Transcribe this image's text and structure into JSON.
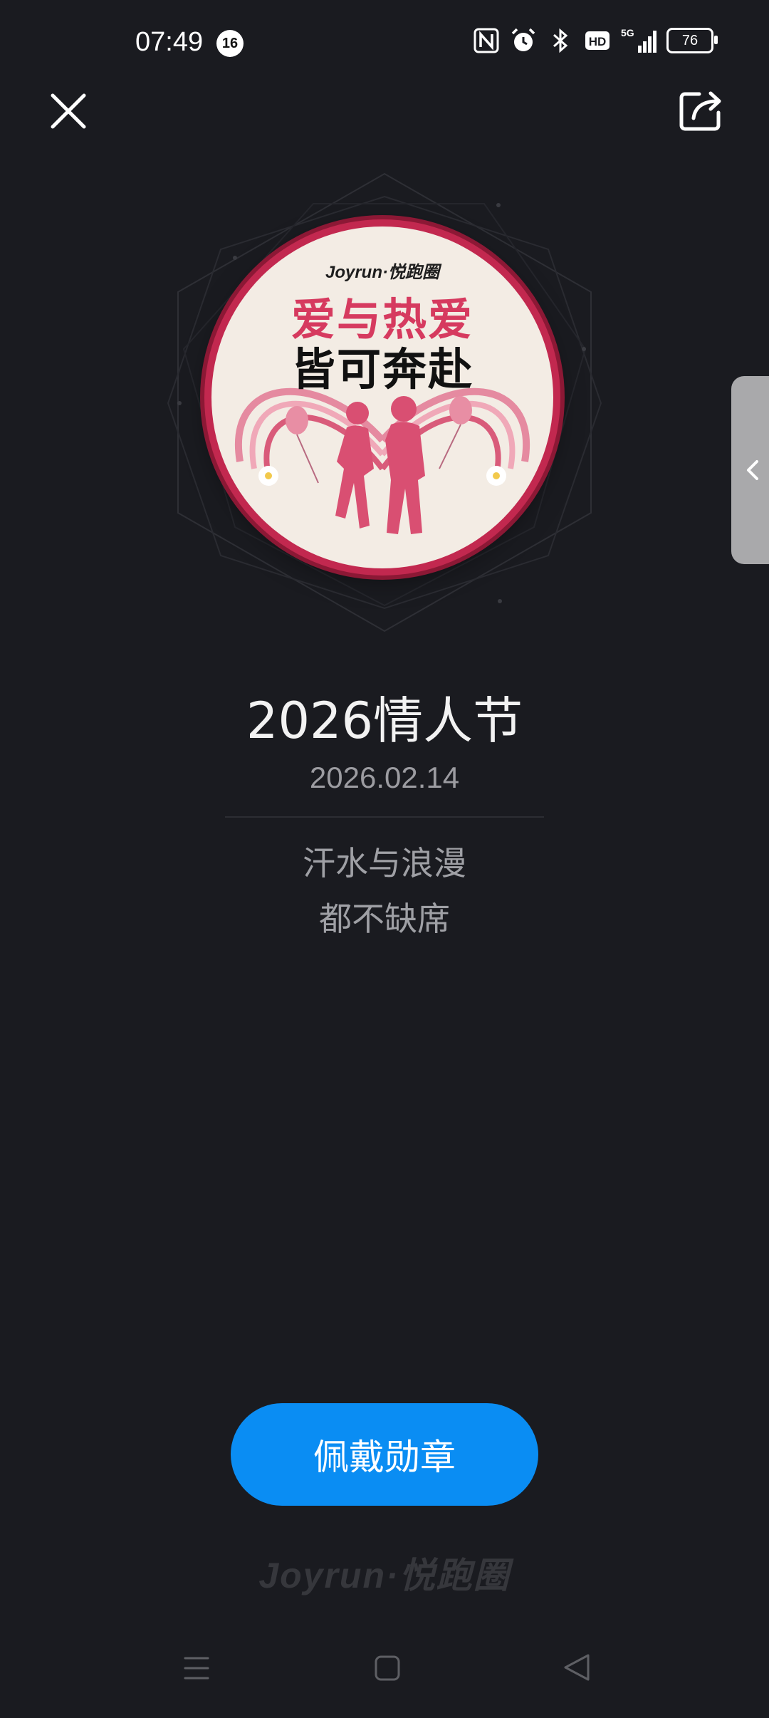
{
  "status_bar": {
    "time": "07:49",
    "notification_count": "16",
    "network": "5G",
    "hd_label": "HD",
    "battery": "76",
    "icons": [
      "nfc-icon",
      "alarm-icon",
      "bluetooth-icon",
      "hd-icon",
      "signal-icon",
      "battery-icon"
    ]
  },
  "top_bar": {
    "close_icon": "close-icon",
    "share_icon": "share-icon"
  },
  "medal": {
    "brand": "Joyrun·悦跑圈",
    "slogan_line1": "爱与热爱",
    "slogan_line2": "皆可奔赴",
    "colors": {
      "ring": "#c2284f",
      "face": "#f3ece4",
      "heart": "#e46b86"
    }
  },
  "side_tab": {
    "icon": "chevron-left-icon"
  },
  "badge_info": {
    "title": "2026情人节",
    "date": "2026.02.14",
    "description_line1": "汗水与浪漫",
    "description_line2": "都不缺席"
  },
  "actions": {
    "wear_label": "佩戴勋章"
  },
  "footer": {
    "logo_text": "Joyrun·悦跑圈"
  },
  "nav_bar": {
    "menu_icon": "menu-icon",
    "home_icon": "home-icon",
    "back_icon": "back-icon"
  },
  "colors": {
    "background": "#1a1b20",
    "accent": "#0a8df3"
  }
}
